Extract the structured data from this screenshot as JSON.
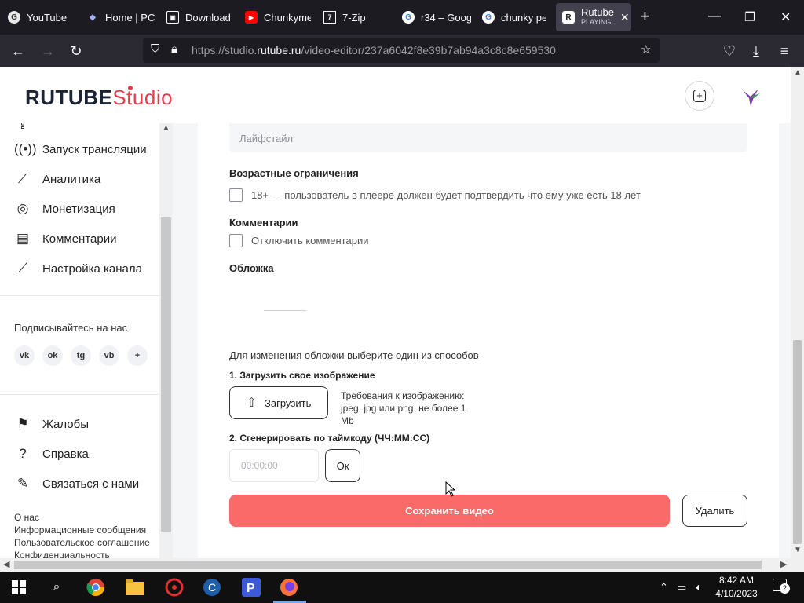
{
  "browser": {
    "tabs": [
      {
        "title": "YouTube",
        "icon": "chrome-icon"
      },
      {
        "title": "Home | PC",
        "icon": "pcgaming-icon"
      },
      {
        "title": "Download",
        "icon": "download-icon"
      },
      {
        "title": "Chunkyme",
        "icon": "youtube-icon"
      },
      {
        "title": "7-Zip",
        "icon": "sevenzip-icon"
      },
      {
        "title": "r34 – Goog",
        "icon": "google-icon"
      },
      {
        "title": "chunky pe",
        "icon": "google-icon"
      },
      {
        "title": "Rutube",
        "subtitle": "PLAYING",
        "icon": "rutube-icon",
        "active": true
      }
    ],
    "url_prefix": "https://studio.",
    "url_domain": "rutube.ru",
    "url_path": "/video-editor/237a6042f8e39b7ab94a3c8c8e659530"
  },
  "header": {
    "logo_main": "RUTUBE",
    "logo_studio": "Studio"
  },
  "sidebar": {
    "items": [
      {
        "label": "Запуск трансляции",
        "icon": "broadcast-icon"
      },
      {
        "label": "Аналитика",
        "icon": "chart-line-icon"
      },
      {
        "label": "Монетизация",
        "icon": "coin-icon"
      },
      {
        "label": "Комментарии",
        "icon": "comments-icon"
      },
      {
        "label": "Настройка канала",
        "icon": "magic-wand-icon"
      }
    ],
    "subscribe_caption": "Подписывайтесь на нас",
    "social": [
      "vk",
      "ok",
      "tg",
      "vb",
      "+"
    ],
    "help_items": [
      {
        "label": "Жалобы",
        "icon": "flag-icon"
      },
      {
        "label": "Справка",
        "icon": "question-icon"
      },
      {
        "label": "Связаться с нами",
        "icon": "edit-icon"
      }
    ],
    "footer_links": [
      "О нас",
      "Информационные сообщения",
      "Пользовательское соглашение",
      "Конфиденциальность"
    ]
  },
  "form": {
    "category_value": "Лайфстайл",
    "age_title": "Возрастные ограничения",
    "age_checkbox": "18+ — пользователь в плеере должен будет подтвердить что ему уже есть 18 лет",
    "comments_title": "Комментарии",
    "comments_checkbox": "Отключить комментарии",
    "cover_title": "Обложка",
    "cover_hint": "Для изменения обложки выберите один из способов",
    "option1_title": "1. Загрузить свое изображение",
    "upload_button": "Загрузить",
    "requirements": "Требования к изображению: jpeg, jpg или png, не более 1 Mb",
    "option2_title": "2. Сгенерировать по таймкоду (ЧЧ:ММ:СС)",
    "timecode_placeholder": "00:00:00",
    "ok_button": "Ок",
    "save_button": "Сохранить видео",
    "delete_button": "Удалить"
  },
  "taskbar": {
    "time": "8:42 AM",
    "date": "4/10/2023",
    "notification_count": "2"
  }
}
